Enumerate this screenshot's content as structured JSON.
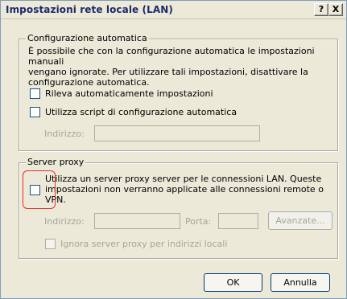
{
  "window": {
    "title": "Impostazioni rete locale (LAN)",
    "help_button": "?",
    "close_button": "X"
  },
  "auto_config": {
    "legend": "Configurazione automatica",
    "description_line1": "È possibile che con la configurazione automatica le impostazioni manuali",
    "description_line2": "vengano ignorate. Per utilizzare tali impostazioni, disattivare la",
    "description_line3": "configurazione automatica.",
    "detect_label": "Rileva automaticamente impostazioni",
    "script_label": "Utilizza script di configurazione automatica",
    "address_label": "Indirizzo:",
    "address_value": ""
  },
  "proxy": {
    "legend": "Server proxy",
    "use_proxy_line1": "Utilizza un server proxy server per le connessioni LAN. Queste",
    "use_proxy_line2": "impostazioni non verranno applicate alle connessioni remote o",
    "use_proxy_line3": "VPN.",
    "address_label": "Indirizzo:",
    "address_value": "",
    "port_label": "Porta:",
    "port_value": "",
    "advanced_label": "Avanzate...",
    "bypass_label": "Ignora server proxy per indirizzi locali"
  },
  "footer": {
    "ok_label": "OK",
    "cancel_label": "Annulla"
  },
  "colors": {
    "dialog_bg": "#ece9d8",
    "title_text": "#1c2a6b",
    "highlight": "#e0302a"
  }
}
